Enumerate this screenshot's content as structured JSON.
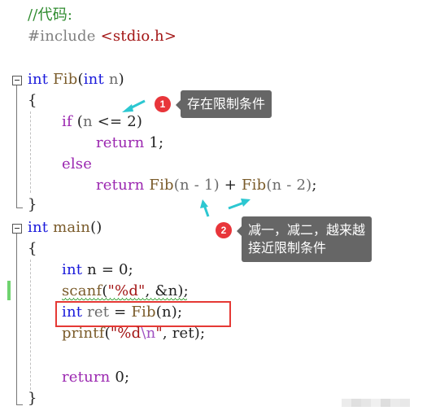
{
  "code": {
    "comment": "//代码:",
    "include_directive": "#include",
    "include_header": "<stdio.h>",
    "fib_signature": {
      "kw1": "int",
      "name": "Fib",
      "open": "(",
      "kw2": "int",
      "param": "n",
      "close": ")"
    },
    "fib_open_brace": "{",
    "if_line": {
      "kw": "if",
      "open": "(",
      "var": "n",
      "op": "<=",
      "num": "2",
      "close": ")"
    },
    "return1": {
      "kw": "return",
      "val": "1;"
    },
    "else_kw": "else",
    "return_fib": {
      "kw": "return",
      "call1": "Fib",
      "args1": "(n - 1)",
      "plus": "+",
      "call2": "Fib",
      "args2": "(n - 2)",
      "end": ";"
    },
    "fib_close_brace": "}",
    "main_signature": {
      "kw": "int",
      "name": "main",
      "parens": "()"
    },
    "main_open_brace": "{",
    "decl_n": {
      "kw": "int",
      "rest": "n = 0;"
    },
    "scanf_line": {
      "fn": "scanf",
      "open": "(",
      "fmt": "\"%d\"",
      "rest": ", &n);"
    },
    "ret_line": {
      "kw": "int",
      "var": "ret",
      "eq": "=",
      "call": "Fib",
      "args": "(n);"
    },
    "printf_line": {
      "fn": "printf",
      "open": "(",
      "fmt1": "\"%d",
      "esc": "\\n",
      "fmt2": "\"",
      "rest": ", ret);"
    },
    "return0": {
      "kw": "return",
      "val": "0;"
    },
    "main_close_brace": "}"
  },
  "annotations": [
    {
      "number": "1",
      "text": "存在限制条件"
    },
    {
      "number": "2",
      "text_line1": "减一，减二，越来越",
      "text_line2": "接近限制条件"
    }
  ],
  "colors": {
    "arrow": "#2cc7d1",
    "badge": "#e8353a",
    "tooltip": "#666666",
    "highlight_box": "#e53935",
    "change_bar": "#6fd36f"
  }
}
